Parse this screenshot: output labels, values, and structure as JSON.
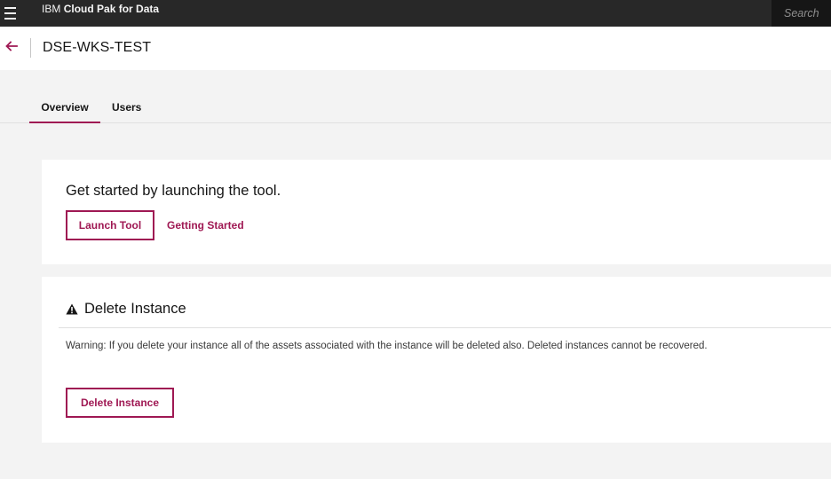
{
  "topbar": {
    "brand_prefix": "IBM",
    "brand_product": "Cloud Pak for Data",
    "search_placeholder": "Search"
  },
  "header": {
    "title": "DSE-WKS-TEST"
  },
  "tabs": [
    {
      "label": "Overview",
      "selected": true
    },
    {
      "label": "Users",
      "selected": false
    }
  ],
  "launch_card": {
    "heading": "Get started by launching the tool.",
    "launch_button": "Launch Tool",
    "getting_started_link": "Getting Started"
  },
  "delete_card": {
    "heading": "Delete Instance",
    "warning": "Warning: If you delete your instance all of the assets associated with the instance will be deleted also. Deleted instances cannot be recovered.",
    "delete_button": "Delete Instance"
  },
  "colors": {
    "accent": "#9f1853",
    "topbar": "#282828",
    "page_bg": "#f3f3f3"
  },
  "icons": {
    "menu": "hamburger-menu-icon",
    "back": "arrow-left-icon",
    "warning": "warning-triangle-icon"
  }
}
